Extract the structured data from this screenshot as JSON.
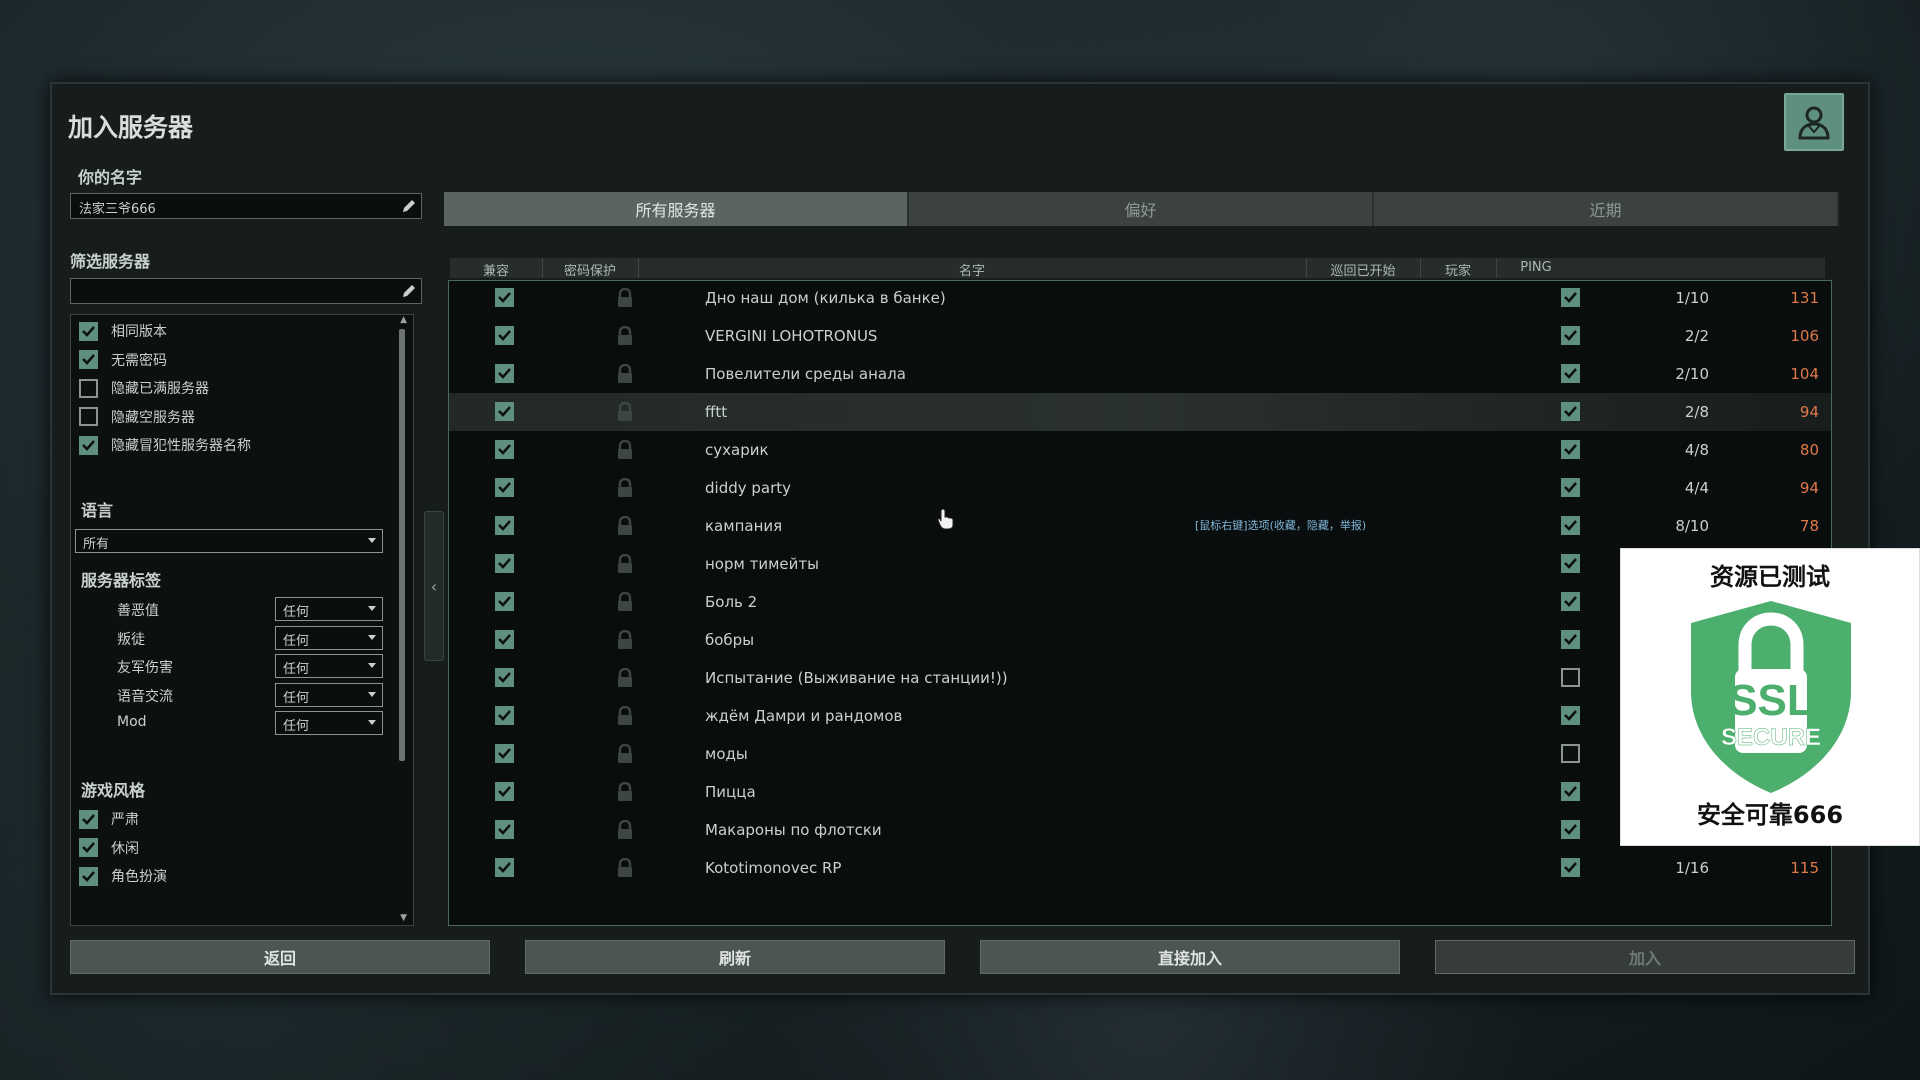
{
  "window": {
    "title": "加入服务器"
  },
  "name_section": {
    "label": "你的名字",
    "value": "法家三爷666"
  },
  "filter_section": {
    "label": "筛选服务器",
    "search_value": ""
  },
  "filters": [
    {
      "label": "相同版本",
      "checked": true
    },
    {
      "label": "无需密码",
      "checked": true
    },
    {
      "label": "隐藏已满服务器",
      "checked": false
    },
    {
      "label": "隐藏空服务器",
      "checked": false
    },
    {
      "label": "隐藏冒犯性服务器名称",
      "checked": true
    }
  ],
  "language": {
    "label": "语言",
    "selected": "所有"
  },
  "server_tags": {
    "label": "服务器标签",
    "items": [
      {
        "label": "善恶值",
        "selected": "任何"
      },
      {
        "label": "叛徒",
        "selected": "任何"
      },
      {
        "label": "友军伤害",
        "selected": "任何"
      },
      {
        "label": "语音交流",
        "selected": "任何"
      },
      {
        "label": "Mod",
        "selected": "任何"
      }
    ]
  },
  "play_style": {
    "label": "游戏风格",
    "items": [
      {
        "label": "严肃",
        "checked": true
      },
      {
        "label": "休闲",
        "checked": true
      },
      {
        "label": "角色扮演",
        "checked": true
      }
    ]
  },
  "tabs": [
    {
      "label": "所有服务器",
      "active": true
    },
    {
      "label": "偏好",
      "active": false
    },
    {
      "label": "近期",
      "active": false
    }
  ],
  "columns": {
    "compatible": "兼容",
    "password": "密码保护",
    "name": "名字",
    "round_started": "巡回已开始",
    "players": "玩家",
    "ping": "PING"
  },
  "servers": [
    {
      "name": "Дно наш дом (килька в банке)",
      "compatible": true,
      "round_started": true,
      "players": "1/10",
      "ping": "131"
    },
    {
      "name": "VERGINI LOHOTRONUS",
      "compatible": true,
      "round_started": true,
      "players": "2/2",
      "ping": "106"
    },
    {
      "name": "Повелители среды анала",
      "compatible": true,
      "round_started": true,
      "players": "2/10",
      "ping": "104"
    },
    {
      "name": "fftt",
      "compatible": true,
      "round_started": true,
      "players": "2/8",
      "ping": "94"
    },
    {
      "name": "сухарик",
      "compatible": true,
      "round_started": true,
      "players": "4/8",
      "ping": "80"
    },
    {
      "name": "diddy party",
      "compatible": true,
      "round_started": true,
      "players": "4/4",
      "ping": "94"
    },
    {
      "name": "кампания",
      "compatible": true,
      "round_started": true,
      "players": "8/10",
      "ping": "78"
    },
    {
      "name": "норм тимейты",
      "compatible": true,
      "round_started": true,
      "players": "",
      "ping": ""
    },
    {
      "name": "Боль 2",
      "compatible": true,
      "round_started": true,
      "players": "",
      "ping": ""
    },
    {
      "name": "бобры",
      "compatible": true,
      "round_started": true,
      "players": "",
      "ping": ""
    },
    {
      "name": "Испытание (Выживание на станции!))",
      "compatible": true,
      "round_started": false,
      "players": "",
      "ping": ""
    },
    {
      "name": "ждём Дамри и рандомов",
      "compatible": true,
      "round_started": true,
      "players": "",
      "ping": ""
    },
    {
      "name": "моды",
      "compatible": true,
      "round_started": false,
      "players": "",
      "ping": ""
    },
    {
      "name": "Пицца",
      "compatible": true,
      "round_started": true,
      "players": "",
      "ping": ""
    },
    {
      "name": "Макароны по флотски",
      "compatible": true,
      "round_started": true,
      "players": "",
      "ping": ""
    },
    {
      "name": "Kototimonovec RP",
      "compatible": true,
      "round_started": true,
      "players": "1/16",
      "ping": "115"
    }
  ],
  "hovered_row": 3,
  "tooltip": "[鼠标右键]选项(收藏，隐藏，举报)",
  "buttons": {
    "back": "返回",
    "refresh": "刷新",
    "direct_join": "直接加入",
    "join": "加入"
  },
  "overlay": {
    "top_text": "资源已测试",
    "ssl_text": "SSL",
    "secure_text": "SECURE",
    "bottom_text": "安全可靠666"
  },
  "colors": {
    "accent": "#5f8f80",
    "ping_orange": "#e0794a",
    "tooltip_blue": "#7fb6d8",
    "shield_green": "#4caf6e"
  }
}
